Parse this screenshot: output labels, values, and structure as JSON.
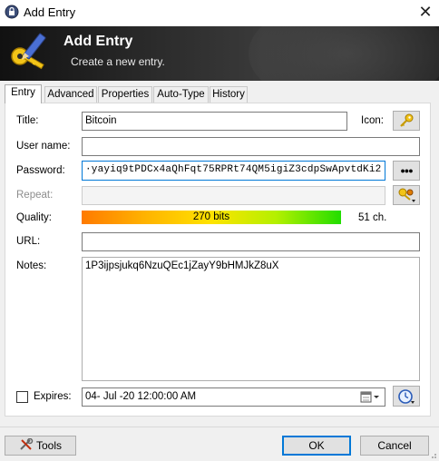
{
  "window": {
    "title": "Add Entry"
  },
  "banner": {
    "title": "Add Entry",
    "subtitle": "Create a new entry."
  },
  "tabs": [
    {
      "label": "Entry",
      "active": true
    },
    {
      "label": "Advanced",
      "active": false
    },
    {
      "label": "Properties",
      "active": false
    },
    {
      "label": "Auto-Type",
      "active": false
    },
    {
      "label": "History",
      "active": false
    }
  ],
  "form": {
    "title_label": "Title:",
    "title_value": "Bitcoin",
    "icon_label": "Icon:",
    "username_label": "User name:",
    "username_value": "",
    "password_label": "Password:",
    "password_value": "·yayiq9tPDCx4aQhFqt75RPRt74QM5igiZ3cdpSwApvtdKi2",
    "repeat_label": "Repeat:",
    "quality_label": "Quality:",
    "quality_value": "270 bits",
    "quality_fill": 1.0,
    "length_value": "51 ch.",
    "url_label": "URL:",
    "url_value": "",
    "notes_label": "Notes:",
    "notes_value": "1P3ijpsjukq6NzuQEc1jZayY9bHMJkZ8uX",
    "expires_label": "Expires:",
    "expires_checked": false,
    "expires_value": "04- Jul -20 12:00:00 AM",
    "show_password_glyph": "●●●"
  },
  "footer": {
    "tools_label": "Tools",
    "ok_label": "OK",
    "cancel_label": "Cancel"
  },
  "icons": {
    "app": "lock-icon",
    "banner": "key-pencil-icon",
    "entry_icon": "key-icon",
    "generator": "key-gear-icon",
    "calendar": "calendar-icon",
    "expiry_picker": "clock-icon",
    "tools": "tools-icon",
    "close": "close-icon"
  },
  "colors": {
    "accent": "#0078d7",
    "banner_bg": "#2b2b2b",
    "quality_start": "#ff7a00",
    "quality_end": "#22dd00"
  }
}
